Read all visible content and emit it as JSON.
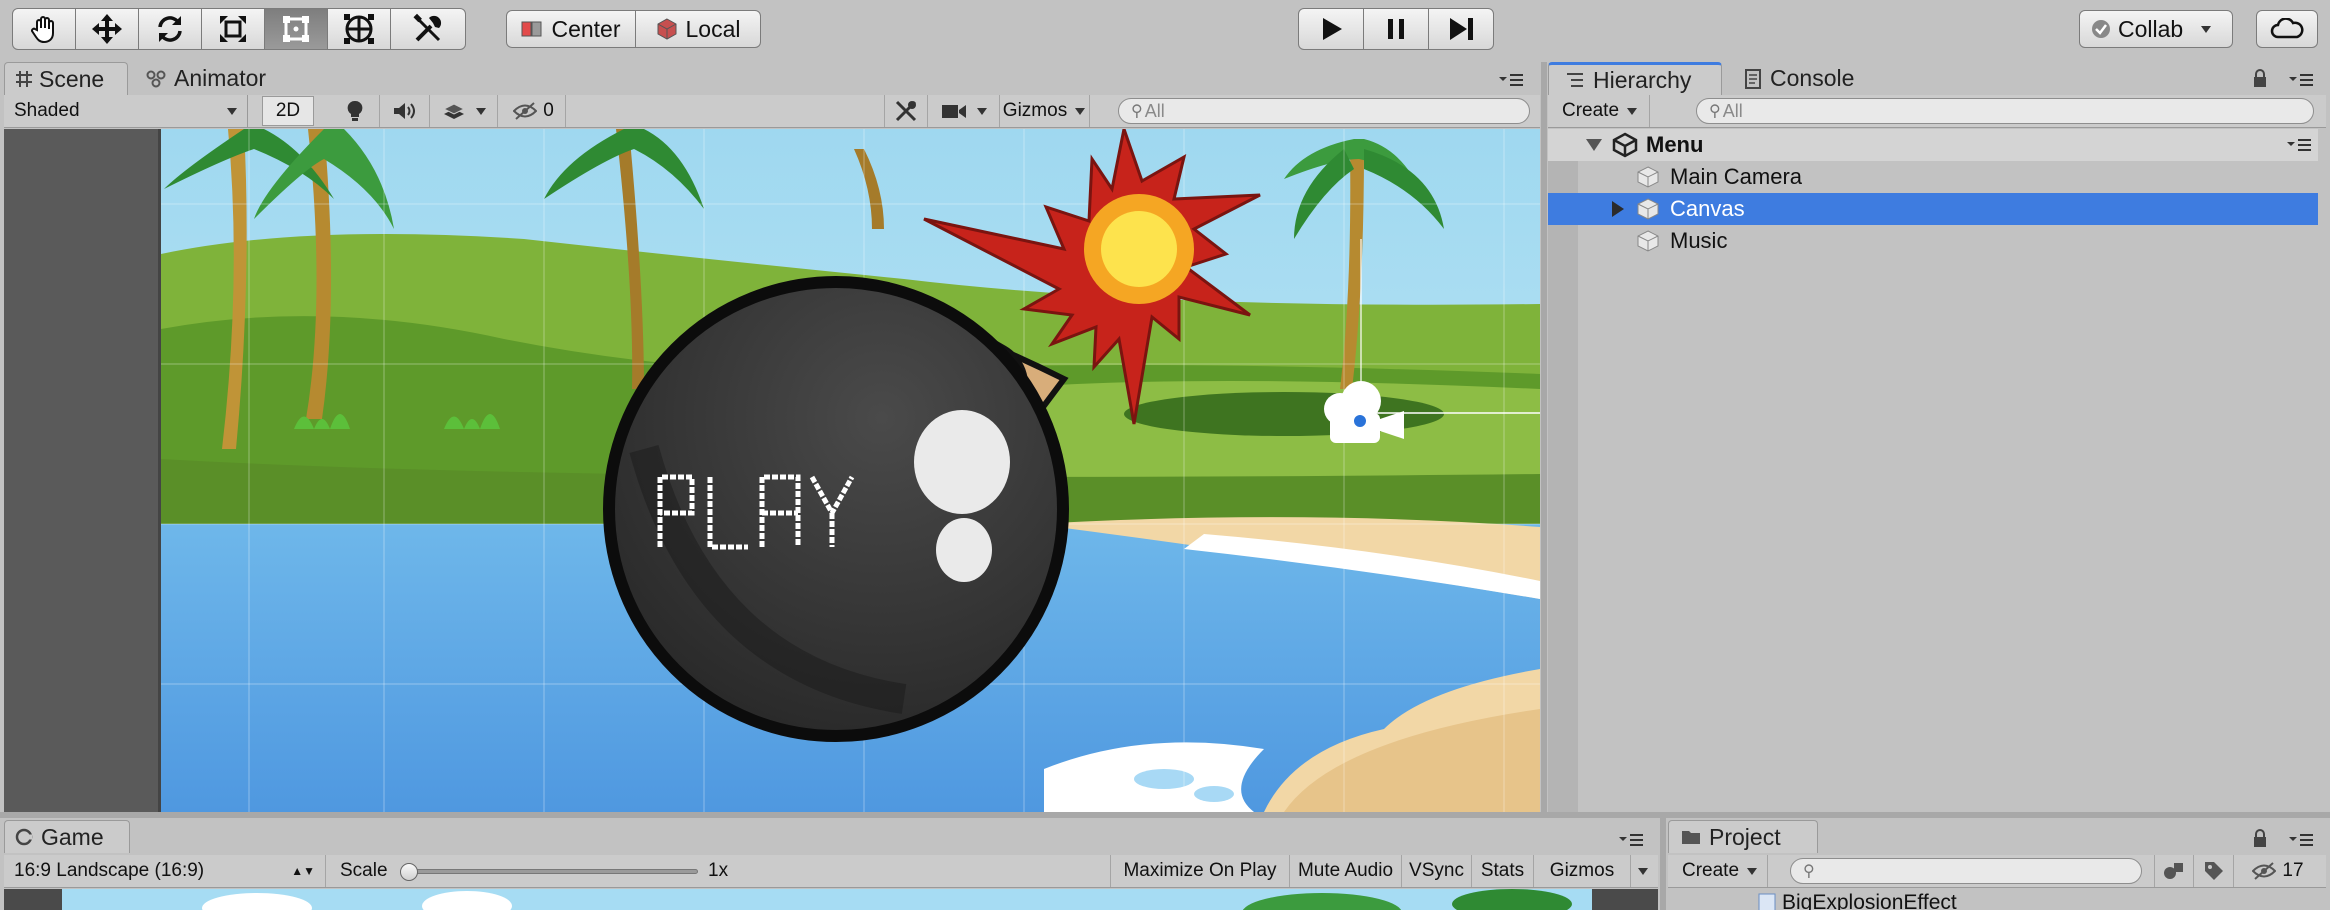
{
  "toolbar": {
    "tools": [
      "hand-tool",
      "move-tool",
      "rotate-tool",
      "scale-tool",
      "rect-tool",
      "transform-tool",
      "custom-tool"
    ],
    "pivot_label": "Center",
    "space_label": "Local",
    "collab_label": "Collab"
  },
  "scene_panel": {
    "tabs": {
      "scene": "Scene",
      "animator": "Animator"
    },
    "shading_mode": "Shaded",
    "mode_2d": "2D",
    "hidden_count": "0",
    "gizmos_label": "Gizmos",
    "search_placeholder": "All",
    "play_text": "PLAY"
  },
  "hierarchy_panel": {
    "tabs": {
      "hierarchy": "Hierarchy",
      "console": "Console"
    },
    "create_label": "Create",
    "search_placeholder": "All",
    "scene_name": "Menu",
    "items": [
      {
        "label": "Main Camera",
        "selected": false,
        "expandable": false
      },
      {
        "label": "Canvas",
        "selected": true,
        "expandable": true
      },
      {
        "label": "Music",
        "selected": false,
        "expandable": false
      }
    ]
  },
  "game_panel": {
    "tab": "Game",
    "aspect": "16:9 Landscape (16:9)",
    "scale_label": "Scale",
    "scale_value": "1x",
    "scale_slider_fraction": 0,
    "buttons": {
      "maximize": "Maximize On Play",
      "mute": "Mute Audio",
      "vsync": "VSync",
      "stats": "Stats",
      "gizmos": "Gizmos"
    }
  },
  "project_panel": {
    "tab": "Project",
    "create_label": "Create",
    "hidden_count": "17",
    "first_item": "BigExplosionEffect"
  },
  "colors": {
    "selection": "#3e7ce0",
    "panel": "#cbcbcb",
    "background": "#c2c2c2"
  }
}
